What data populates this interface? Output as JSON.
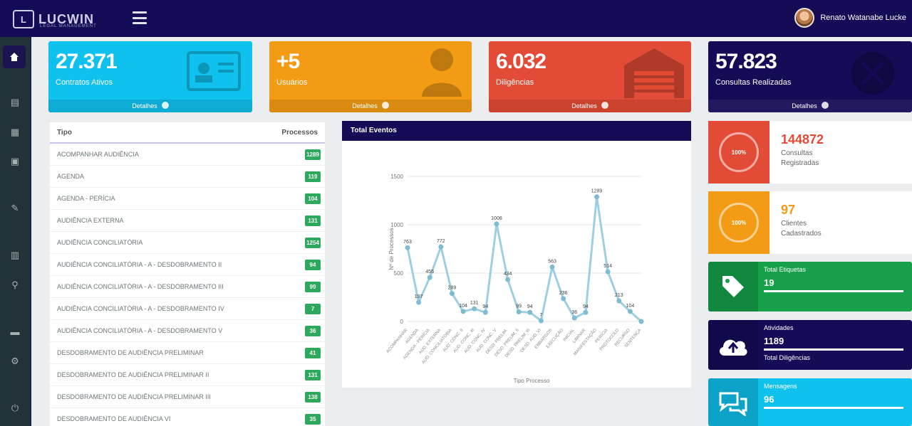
{
  "header": {
    "logo_text": "LUCWIN",
    "logo_sub": "LEGAL MANAGEMENT",
    "user_name": "Renato Watanabe Lucke"
  },
  "cards": [
    {
      "value": "27.371",
      "label": "Contratos Ativos",
      "footer": "Detalhes",
      "color": "#10c0ed"
    },
    {
      "value": "+5",
      "label": "Usuários",
      "footer": "Detalhes",
      "color": "#f39b14"
    },
    {
      "value": "6.032",
      "label": "Diligências",
      "footer": "Detalhes",
      "color": "#e24b35"
    },
    {
      "value": "57.823",
      "label": "Consultas Realizadas",
      "footer": "Detalhes",
      "color": "#160b57"
    }
  ],
  "table": {
    "col_type": "Tipo",
    "col_count": "Processos",
    "rows": [
      {
        "name": "ACOMPANHAR AUDIÊNCIA",
        "count": "1289"
      },
      {
        "name": "AGENDA",
        "count": "119"
      },
      {
        "name": "AGENDA - PERÍCIA",
        "count": "104"
      },
      {
        "name": "AUDIÊNCIA EXTERNA",
        "count": "131"
      },
      {
        "name": "AUDIÊNCIA CONCILIATÓRIA",
        "count": "1254"
      },
      {
        "name": "AUDIÊNCIA CONCILIATÓRIA - A - DESDOBRAMENTO II",
        "count": "94"
      },
      {
        "name": "AUDIÊNCIA CONCILIATÓRIA - A - DESDOBRAMENTO III",
        "count": "99"
      },
      {
        "name": "AUDIÊNCIA CONCILIATÓRIA - A - DESDOBRAMENTO IV",
        "count": "7"
      },
      {
        "name": "AUDIÊNCIA CONCILIATÓRIA - A - DESDOBRAMENTO V",
        "count": "36"
      },
      {
        "name": "DESDOBRAMENTO DE AUDIÊNCIA PRELIMINAR",
        "count": "41"
      },
      {
        "name": "DESDOBRAMENTO DE AUDIÊNCIA PRELIMINAR II",
        "count": "131"
      },
      {
        "name": "DESDOBRAMENTO DE AUDIÊNCIA PRELIMINAR III",
        "count": "138"
      },
      {
        "name": "DESDOBRAMENTO DE AUDIÊNCIA VI",
        "count": "35"
      }
    ]
  },
  "chart_panel": {
    "title": "Total Eventos"
  },
  "chart_data": {
    "type": "line",
    "title": "Total Eventos",
    "xlabel": "Tipo Processo",
    "ylabel": "Nº de Processos",
    "ylim": [
      0,
      1500
    ],
    "yticks": [
      0,
      500,
      1000,
      1500
    ],
    "categories": [
      "ACOMPANHAR",
      "AGENDA",
      "AGENDA - PERÍCIA",
      "AUD. EXTERNA",
      "AUD. CONCILIATÓRIA",
      "AUD. CONC. II",
      "AUD. CONC. III",
      "AUD. CONC. IV",
      "AUD. CONC. V",
      "DESD. PRELIM.",
      "DESD. PRELIM. II",
      "DESD. PRELIM. III",
      "DESD. AUD. VI",
      "EMBARGOS",
      "EXECUÇÃO",
      "INICIAL",
      "LIMINAR",
      "MANIFESTAÇÃO",
      "PERÍCIA",
      "PROTOCOLO",
      "RECURSO",
      "SENTENÇA"
    ],
    "values": [
      763,
      197,
      455,
      772,
      289,
      104,
      131,
      94,
      1008,
      434,
      99,
      94,
      7,
      563,
      236,
      36,
      94,
      1289,
      514,
      213,
      104,
      0
    ],
    "point_labels": [
      "763",
      "197",
      "455",
      "772",
      "289",
      "104",
      "131",
      "94",
      "1008",
      "434",
      "99",
      "94",
      "7",
      "563",
      "236",
      "36",
      "94",
      "1289",
      "514",
      "213",
      "104",
      ""
    ],
    "grid": true,
    "legend": "none"
  },
  "rings": [
    {
      "value": "144872",
      "line1": "Consultas",
      "line2": "Registradas",
      "ring_text": "100%",
      "color": "#e24b35"
    },
    {
      "value": "97",
      "line1": "Clientes",
      "line2": "Cadastrados",
      "ring_text": "100%",
      "color": "#f39b14"
    }
  ],
  "info_cards": [
    {
      "title": "Total Etiquetas",
      "value": "19",
      "foot": "",
      "progress": 1.0,
      "color": "#15a049",
      "icon": "tag-icon"
    },
    {
      "title": "Atividades",
      "value": "1189",
      "foot": "Total Diligências",
      "progress": 1.0,
      "color": "#160b57",
      "icon": "cloud-upload-icon"
    },
    {
      "title": "Mensagens",
      "value": "96",
      "foot": "",
      "progress": 1.0,
      "color": "#10c0ed",
      "icon": "chat-icon"
    }
  ]
}
